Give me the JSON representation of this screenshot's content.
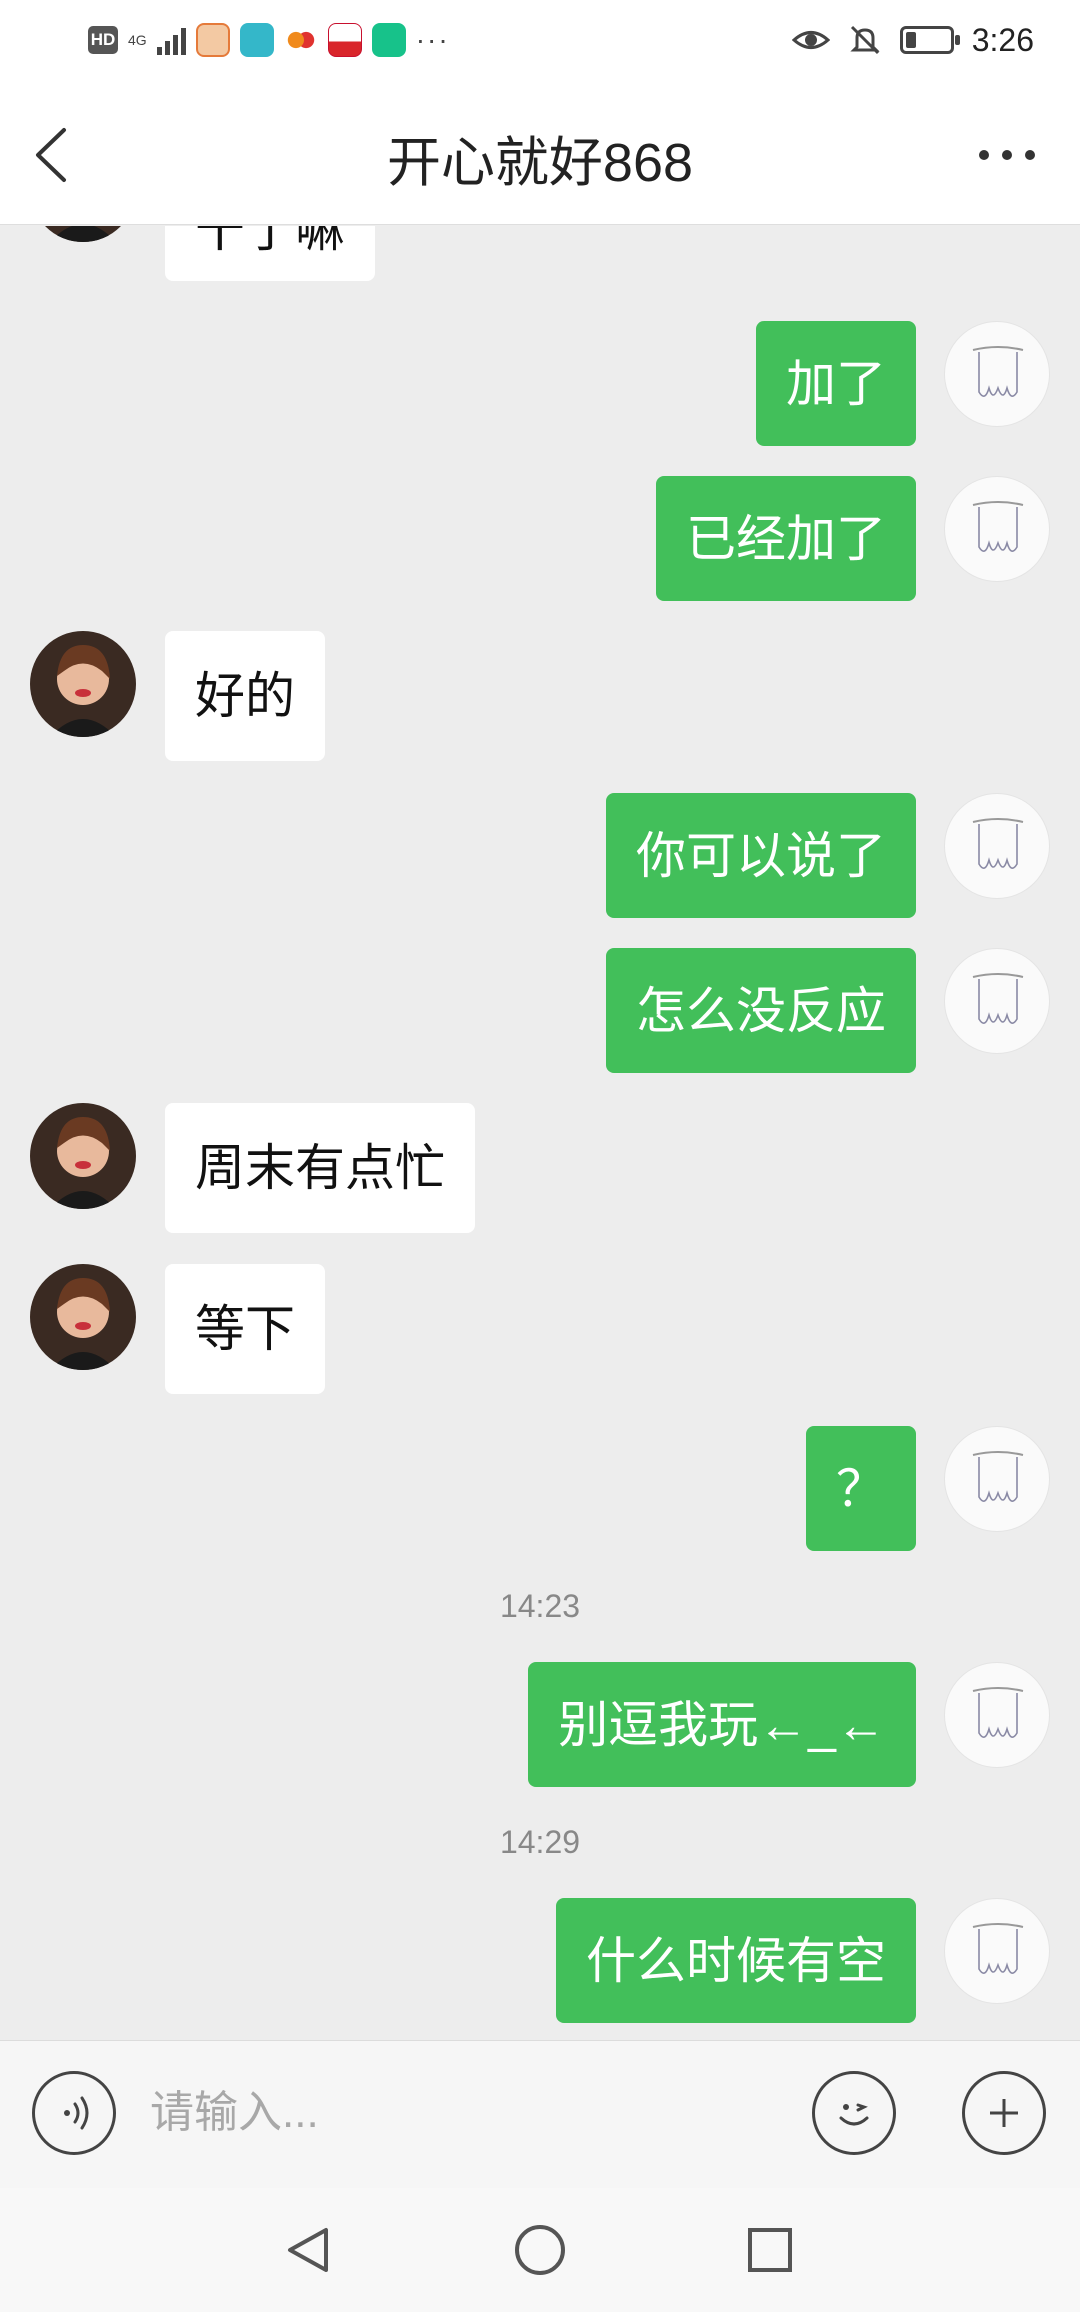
{
  "status_bar": {
    "hd_label": "HD",
    "network": "4G",
    "time": "3:26",
    "notification_icons": [
      "photo-app-icon",
      "boss-app-icon",
      "flower-app-icon",
      "sports-app-icon",
      "green-app-icon"
    ],
    "more_notifications": "···"
  },
  "header": {
    "title": "开心就好868",
    "back_icon": "chevron-left-icon",
    "more_icon": "more-dots-icon"
  },
  "messages": [
    {
      "side": "in",
      "text": "干了嘛",
      "partial": true
    },
    {
      "side": "out",
      "text": "加了"
    },
    {
      "side": "out",
      "text": "已经加了"
    },
    {
      "side": "in",
      "text": "好的"
    },
    {
      "side": "out",
      "text": "你可以说了"
    },
    {
      "side": "out",
      "text": "怎么没反应"
    },
    {
      "side": "in",
      "text": "周末有点忙"
    },
    {
      "side": "in",
      "text": "等下"
    },
    {
      "side": "out",
      "text": "？"
    },
    {
      "type": "time",
      "text": "14:23"
    },
    {
      "side": "out",
      "text": "别逗我玩←_←"
    },
    {
      "type": "time",
      "text": "14:29"
    },
    {
      "side": "out",
      "text": "什么时候有空"
    }
  ],
  "input_bar": {
    "placeholder": "请输入...",
    "value": "",
    "voice_icon": "voice-icon",
    "emoji_icon": "emoji-icon",
    "plus_icon": "plus-icon"
  },
  "nav_bar": {
    "back": "triangle-back-icon",
    "home": "circle-home-icon",
    "recents": "square-recents-icon"
  },
  "colors": {
    "outgoing_bubble": "#42bf5a",
    "incoming_bubble": "#ffffff",
    "chat_background": "#ededed"
  }
}
